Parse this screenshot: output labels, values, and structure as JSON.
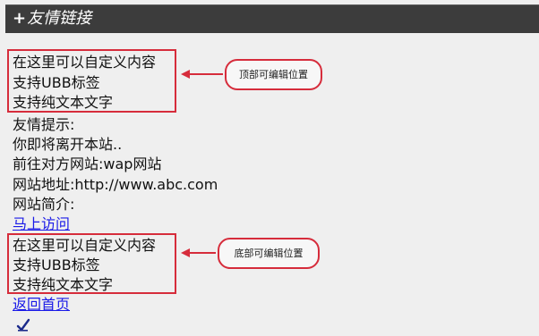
{
  "header": {
    "icon": "plus-icon",
    "title": "友情链接"
  },
  "top_block": {
    "lines": [
      "在这里可以自定义内容",
      "支持UBB标签",
      "支持纯文本文字"
    ]
  },
  "top_callout": "顶部可编辑位置",
  "content": {
    "tip_heading": "友情提示:",
    "leaving": "你即将离开本站..",
    "goto": "前往对方网站:wap网站",
    "url": "网站地址:http://www.abc.com",
    "intro": "网站简介:",
    "visit_link": "马上访问"
  },
  "bottom_block": {
    "lines": [
      "在这里可以自定义内容",
      "支持UBB标签",
      "支持纯文本文字"
    ]
  },
  "bottom_callout": "底部可编辑位置",
  "footer": {
    "home_link": "返回首页",
    "icon": "check-pen-icon"
  },
  "colors": {
    "header_bg": "#3c3c3c",
    "page_bg": "#efefef",
    "link": "#1a1ae8",
    "annotation_red": "#d62c3b"
  }
}
